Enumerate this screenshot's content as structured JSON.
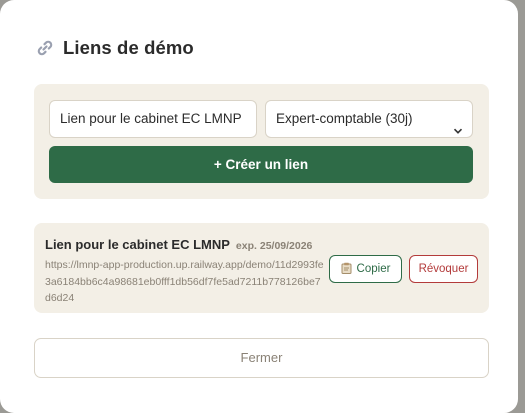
{
  "modal": {
    "title": "Liens de démo",
    "title_icon": "link-icon"
  },
  "form": {
    "label_value": "Lien pour le cabinet EC LMNP",
    "profile_selected": "Expert-comptable (30j)",
    "create_label": "+ Créer un lien"
  },
  "links": [
    {
      "name": "Lien pour le cabinet EC LMNP",
      "expiry": "exp. 25/09/2026",
      "url": "https://lmnp-app-production.up.railway.app/demo/11d2993fe3a6184bb6c4a98681eb0fff1db56df7fe5ad7211b778126be7d6d24",
      "copy_label": "Copier",
      "revoke_label": "Révoquer"
    }
  ],
  "footer": {
    "close_label": "Fermer"
  },
  "colors": {
    "primary": "#2e6b47",
    "danger": "#b33b3b",
    "card_bg": "#f3efe6"
  }
}
